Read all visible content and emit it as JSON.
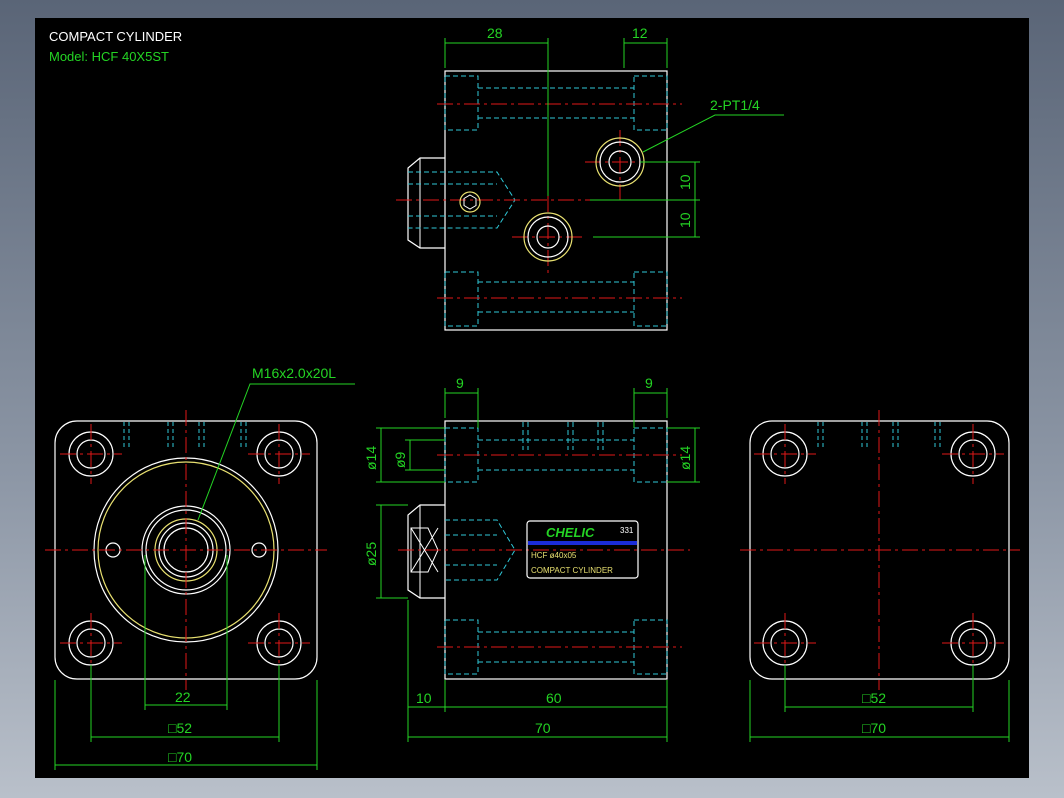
{
  "title_block": {
    "title": "COMPACT CYLINDER",
    "model": "Model: HCF 40X5ST"
  },
  "colors": {
    "background": "#000000",
    "outline": "#ffffff",
    "hidden": "#2fc8d8",
    "center": "#e01818",
    "dimension": "#24d424",
    "thread": "#e8e070",
    "label_blue": "#1a2cd8"
  },
  "annotations": {
    "port_callout": "2-PT1/4",
    "thread_callout": "M16x2.0x20L"
  },
  "dimensions": {
    "top_28": "28",
    "top_12": "12",
    "top_10a": "10",
    "top_10b": "10",
    "side_9a": "9",
    "side_9b": "9",
    "side_d14_left": "ø14",
    "side_d9": "ø9",
    "side_d14_right": "ø14",
    "side_d25": "ø25",
    "side_10": "10",
    "side_60": "60",
    "side_70": "70",
    "front_22": "22",
    "front_sq52": "□52",
    "front_sq70": "□70",
    "rear_sq52": "□52",
    "rear_sq70": "□70"
  },
  "label_plate": {
    "brand": "CHELIC",
    "code": "331",
    "model_line": "HCF ø40x05",
    "description": "COMPACT CYLINDER"
  }
}
